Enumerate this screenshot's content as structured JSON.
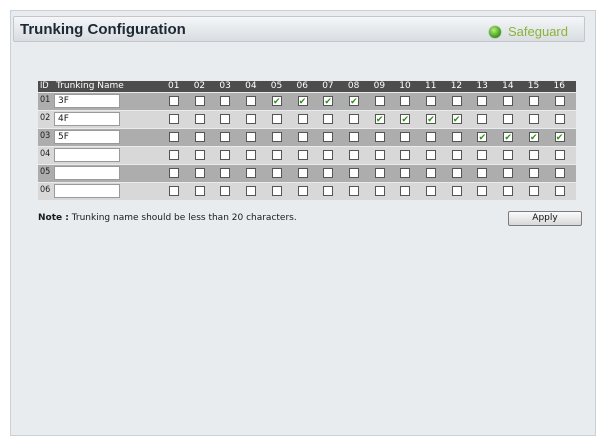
{
  "header": {
    "title": "Trunking Configuration",
    "safeguard_label": "Safeguard",
    "safeguard_icon": "safeguard-status-icon"
  },
  "table": {
    "id_header": "ID",
    "name_header": "Trunking Name",
    "ports": [
      "01",
      "02",
      "03",
      "04",
      "05",
      "06",
      "07",
      "08",
      "09",
      "10",
      "11",
      "12",
      "13",
      "14",
      "15",
      "16"
    ],
    "rows": [
      {
        "id": "01",
        "name": "3F",
        "checked": [
          false,
          false,
          false,
          false,
          true,
          true,
          true,
          true,
          false,
          false,
          false,
          false,
          false,
          false,
          false,
          false
        ]
      },
      {
        "id": "02",
        "name": "4F",
        "checked": [
          false,
          false,
          false,
          false,
          false,
          false,
          false,
          false,
          true,
          true,
          true,
          true,
          false,
          false,
          false,
          false
        ]
      },
      {
        "id": "03",
        "name": "5F",
        "checked": [
          false,
          false,
          false,
          false,
          false,
          false,
          false,
          false,
          false,
          false,
          false,
          false,
          true,
          true,
          true,
          true
        ]
      },
      {
        "id": "04",
        "name": "",
        "checked": [
          false,
          false,
          false,
          false,
          false,
          false,
          false,
          false,
          false,
          false,
          false,
          false,
          false,
          false,
          false,
          false
        ]
      },
      {
        "id": "05",
        "name": "",
        "checked": [
          false,
          false,
          false,
          false,
          false,
          false,
          false,
          false,
          false,
          false,
          false,
          false,
          false,
          false,
          false,
          false
        ]
      },
      {
        "id": "06",
        "name": "",
        "checked": [
          false,
          false,
          false,
          false,
          false,
          false,
          false,
          false,
          false,
          false,
          false,
          false,
          false,
          false,
          false,
          false
        ]
      }
    ]
  },
  "note": {
    "label": "Note :",
    "text": " Trunking name should be less than 20 characters."
  },
  "apply_label": "Apply",
  "colors": {
    "header_bg": "#4d4d4d",
    "row_dark": "#adadad",
    "row_light": "#d8d8d8",
    "check_green": "#2d8d1a",
    "safeguard_green": "#8bb33a"
  }
}
